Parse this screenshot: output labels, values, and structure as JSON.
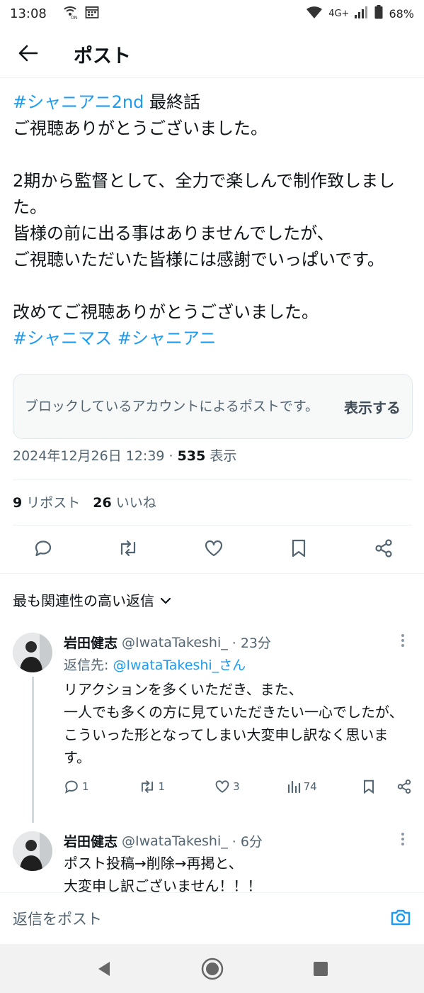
{
  "status_bar": {
    "time": "13:08",
    "network": "4G+",
    "battery": "68%",
    "icons": [
      "wifi-call-icon",
      "calendar-icon",
      "wifi-icon",
      "signal-icon",
      "battery-icon"
    ]
  },
  "header": {
    "title": "ポスト"
  },
  "post": {
    "line1_hashtag": "#シャニアニ2nd",
    "line1_rest": " 最終話",
    "line2": "ご視聴ありがとうございました。",
    "para2": "2期から監督として、全力で楽しんで制作致しました。",
    "para3a": "皆様の前に出る事はありませんでしたが、",
    "para3b": "ご視聴いただいた皆様には感謝でいっぱいです。",
    "para4": "改めてご視聴ありがとうございました。",
    "hashtag2": "#シャニマス",
    "hashtag3": "#シャニアニ"
  },
  "blocked_notice": {
    "message": "ブロックしているアカウントによるポストです。",
    "show_label": "表示する"
  },
  "meta": {
    "datetime": "2024年12月26日 12:39",
    "separator": " · ",
    "views_count": "535",
    "views_label": " 表示"
  },
  "stats": {
    "reposts_count": "9",
    "reposts_label": "リポスト",
    "likes_count": "26",
    "likes_label": "いいね"
  },
  "sort": {
    "label": "最も関連性の高い返信"
  },
  "replies": [
    {
      "name": "岩田健志",
      "handle": "@IwataTakeshi_",
      "time": "· 23分",
      "reply_to_label": "返信先: ",
      "reply_to_handle": "@IwataTakeshi_さん",
      "text": "リアクションを多くいただき、また、\n一人でも多くの方に見ていただきたい一心でしたが、\nこういった形となってしまい大変申し訳なく思います。",
      "replies_count": "1",
      "reposts_count": "1",
      "likes_count": "3",
      "views_count": "74"
    },
    {
      "name": "岩田健志",
      "handle": "@IwataTakeshi_",
      "time": "· 6分",
      "text": "ポスト投稿→削除→再掲と、\n大変申し訳ございません！！！"
    }
  ],
  "composer": {
    "placeholder": "返信をポスト"
  },
  "colors": {
    "accent": "#1d9bf0",
    "secondary_text": "#536471",
    "primary_text": "#0f1419"
  }
}
